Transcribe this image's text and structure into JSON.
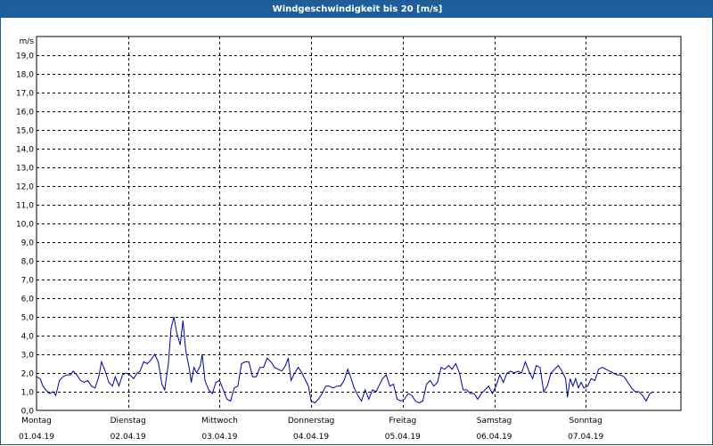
{
  "window": {
    "title": "Windgeschwindigkeit bis 20 [m/s]"
  },
  "colors": {
    "titlebar": "#1e5f9b",
    "line": "#0000a0",
    "grid": "#000000"
  },
  "chart_data": {
    "type": "line",
    "title": "Windgeschwindigkeit bis 20 [m/s]",
    "ylabel": "m/s",
    "ylim": [
      0,
      20
    ],
    "yticks": [
      "0,0",
      "1,0",
      "2,0",
      "3,0",
      "4,0",
      "5,0",
      "6,0",
      "7,0",
      "8,0",
      "9,0",
      "10,0",
      "11,0",
      "12,0",
      "13,0",
      "14,0",
      "15,0",
      "16,0",
      "17,0",
      "18,0",
      "19,0"
    ],
    "grid": true,
    "xlim": [
      0,
      7
    ],
    "days": [
      {
        "weekday": "Montag",
        "date": "01.04.19"
      },
      {
        "weekday": "Dienstag",
        "date": "02.04.19"
      },
      {
        "weekday": "Mittwoch",
        "date": "03.04.19"
      },
      {
        "weekday": "Donnerstag",
        "date": "04.04.19"
      },
      {
        "weekday": "Freitag",
        "date": "05.04.19"
      },
      {
        "weekday": "Samstag",
        "date": "06.04.19"
      },
      {
        "weekday": "Sonntag",
        "date": "07.04.19"
      }
    ],
    "series": [
      {
        "values": [
          [
            0.0,
            1.8
          ],
          [
            0.04,
            1.7
          ],
          [
            0.07,
            1.3
          ],
          [
            0.1,
            1.1
          ],
          [
            0.14,
            0.9
          ],
          [
            0.18,
            1.0
          ],
          [
            0.21,
            0.8
          ],
          [
            0.25,
            1.6
          ],
          [
            0.29,
            1.8
          ],
          [
            0.33,
            1.9
          ],
          [
            0.37,
            1.9
          ],
          [
            0.4,
            2.1
          ],
          [
            0.44,
            1.9
          ],
          [
            0.48,
            1.6
          ],
          [
            0.52,
            1.5
          ],
          [
            0.56,
            1.6
          ],
          [
            0.6,
            1.3
          ],
          [
            0.64,
            1.2
          ],
          [
            0.68,
            1.8
          ],
          [
            0.71,
            2.6
          ],
          [
            0.75,
            2.1
          ],
          [
            0.79,
            1.5
          ],
          [
            0.83,
            1.3
          ],
          [
            0.86,
            1.8
          ],
          [
            0.9,
            1.3
          ],
          [
            0.94,
            1.9
          ],
          [
            0.98,
            2.0
          ],
          [
            1.02,
            1.9
          ],
          [
            1.06,
            1.7
          ],
          [
            1.1,
            2.0
          ],
          [
            1.13,
            2.1
          ],
          [
            1.17,
            2.6
          ],
          [
            1.21,
            2.5
          ],
          [
            1.25,
            2.7
          ],
          [
            1.29,
            3.0
          ],
          [
            1.33,
            2.6
          ],
          [
            1.37,
            1.4
          ],
          [
            1.4,
            1.1
          ],
          [
            1.44,
            2.5
          ],
          [
            1.47,
            4.4
          ],
          [
            1.5,
            5.0
          ],
          [
            1.53,
            4.2
          ],
          [
            1.57,
            3.5
          ],
          [
            1.6,
            4.8
          ],
          [
            1.63,
            3.2
          ],
          [
            1.67,
            2.2
          ],
          [
            1.69,
            1.5
          ],
          [
            1.72,
            2.3
          ],
          [
            1.75,
            2.0
          ],
          [
            1.79,
            2.4
          ],
          [
            1.81,
            3.0
          ],
          [
            1.84,
            1.6
          ],
          [
            1.88,
            1.1
          ],
          [
            1.92,
            0.9
          ],
          [
            1.96,
            1.5
          ],
          [
            2.0,
            1.6
          ],
          [
            2.04,
            1.1
          ],
          [
            2.08,
            0.6
          ],
          [
            2.12,
            0.5
          ],
          [
            2.16,
            1.2
          ],
          [
            2.2,
            1.3
          ],
          [
            2.24,
            2.5
          ],
          [
            2.28,
            2.6
          ],
          [
            2.32,
            2.6
          ],
          [
            2.36,
            1.8
          ],
          [
            2.4,
            1.8
          ],
          [
            2.44,
            2.3
          ],
          [
            2.48,
            2.3
          ],
          [
            2.52,
            2.8
          ],
          [
            2.56,
            2.6
          ],
          [
            2.6,
            2.3
          ],
          [
            2.64,
            2.2
          ],
          [
            2.68,
            2.1
          ],
          [
            2.72,
            2.4
          ],
          [
            2.75,
            2.8
          ],
          [
            2.78,
            1.6
          ],
          [
            2.82,
            2.0
          ],
          [
            2.86,
            2.3
          ],
          [
            2.9,
            2.0
          ],
          [
            2.94,
            1.6
          ],
          [
            2.97,
            1.3
          ],
          [
            3.0,
            0.5
          ],
          [
            3.04,
            0.4
          ],
          [
            3.08,
            0.6
          ],
          [
            3.12,
            0.9
          ],
          [
            3.16,
            1.3
          ],
          [
            3.2,
            1.3
          ],
          [
            3.24,
            1.2
          ],
          [
            3.28,
            1.3
          ],
          [
            3.32,
            1.3
          ],
          [
            3.36,
            1.6
          ],
          [
            3.4,
            2.2
          ],
          [
            3.43,
            1.8
          ],
          [
            3.47,
            1.2
          ],
          [
            3.51,
            0.8
          ],
          [
            3.55,
            0.5
          ],
          [
            3.59,
            1.1
          ],
          [
            3.63,
            0.6
          ],
          [
            3.67,
            1.1
          ],
          [
            3.71,
            1.0
          ],
          [
            3.74,
            1.3
          ],
          [
            3.78,
            1.7
          ],
          [
            3.82,
            1.9
          ],
          [
            3.86,
            1.3
          ],
          [
            3.9,
            1.4
          ],
          [
            3.94,
            0.6
          ],
          [
            3.98,
            0.5
          ],
          [
            4.02,
            0.6
          ],
          [
            4.06,
            0.9
          ],
          [
            4.1,
            0.8
          ],
          [
            4.14,
            0.5
          ],
          [
            4.18,
            0.4
          ],
          [
            4.22,
            0.5
          ],
          [
            4.26,
            1.4
          ],
          [
            4.3,
            1.6
          ],
          [
            4.34,
            1.3
          ],
          [
            4.38,
            1.5
          ],
          [
            4.42,
            2.3
          ],
          [
            4.46,
            2.2
          ],
          [
            4.5,
            2.4
          ],
          [
            4.54,
            2.2
          ],
          [
            4.58,
            2.5
          ],
          [
            4.62,
            2.0
          ],
          [
            4.66,
            1.1
          ],
          [
            4.7,
            1.1
          ],
          [
            4.74,
            0.9
          ],
          [
            4.78,
            0.9
          ],
          [
            4.82,
            0.6
          ],
          [
            4.86,
            0.9
          ],
          [
            4.9,
            1.1
          ],
          [
            4.94,
            1.3
          ],
          [
            4.98,
            0.9
          ],
          [
            5.02,
            1.3
          ],
          [
            5.06,
            1.9
          ],
          [
            5.1,
            1.5
          ],
          [
            5.14,
            2.0
          ],
          [
            5.18,
            2.1
          ],
          [
            5.22,
            2.0
          ],
          [
            5.26,
            2.1
          ],
          [
            5.3,
            2.0
          ],
          [
            5.34,
            2.6
          ],
          [
            5.38,
            2.1
          ],
          [
            5.42,
            1.7
          ],
          [
            5.46,
            2.4
          ],
          [
            5.5,
            2.3
          ],
          [
            5.54,
            1.0
          ],
          [
            5.58,
            1.3
          ],
          [
            5.62,
            2.0
          ],
          [
            5.66,
            2.2
          ],
          [
            5.7,
            2.4
          ],
          [
            5.74,
            2.1
          ],
          [
            5.78,
            1.7
          ],
          [
            5.8,
            0.7
          ],
          [
            5.83,
            1.7
          ],
          [
            5.86,
            1.3
          ],
          [
            5.89,
            1.7
          ],
          [
            5.92,
            1.2
          ],
          [
            5.95,
            1.5
          ],
          [
            5.98,
            1.2
          ],
          [
            6.02,
            1.3
          ],
          [
            6.06,
            1.7
          ],
          [
            6.1,
            1.6
          ],
          [
            6.14,
            2.2
          ],
          [
            6.18,
            2.3
          ],
          [
            6.22,
            2.2
          ],
          [
            6.26,
            2.1
          ],
          [
            6.3,
            2.0
          ],
          [
            6.34,
            1.9
          ],
          [
            6.38,
            1.9
          ],
          [
            6.42,
            1.8
          ],
          [
            6.46,
            1.5
          ],
          [
            6.5,
            1.2
          ],
          [
            6.54,
            1.0
          ],
          [
            6.58,
            1.0
          ],
          [
            6.62,
            0.8
          ],
          [
            6.66,
            0.5
          ],
          [
            6.7,
            0.9
          ],
          [
            6.74,
            1.0
          ]
        ]
      }
    ]
  }
}
